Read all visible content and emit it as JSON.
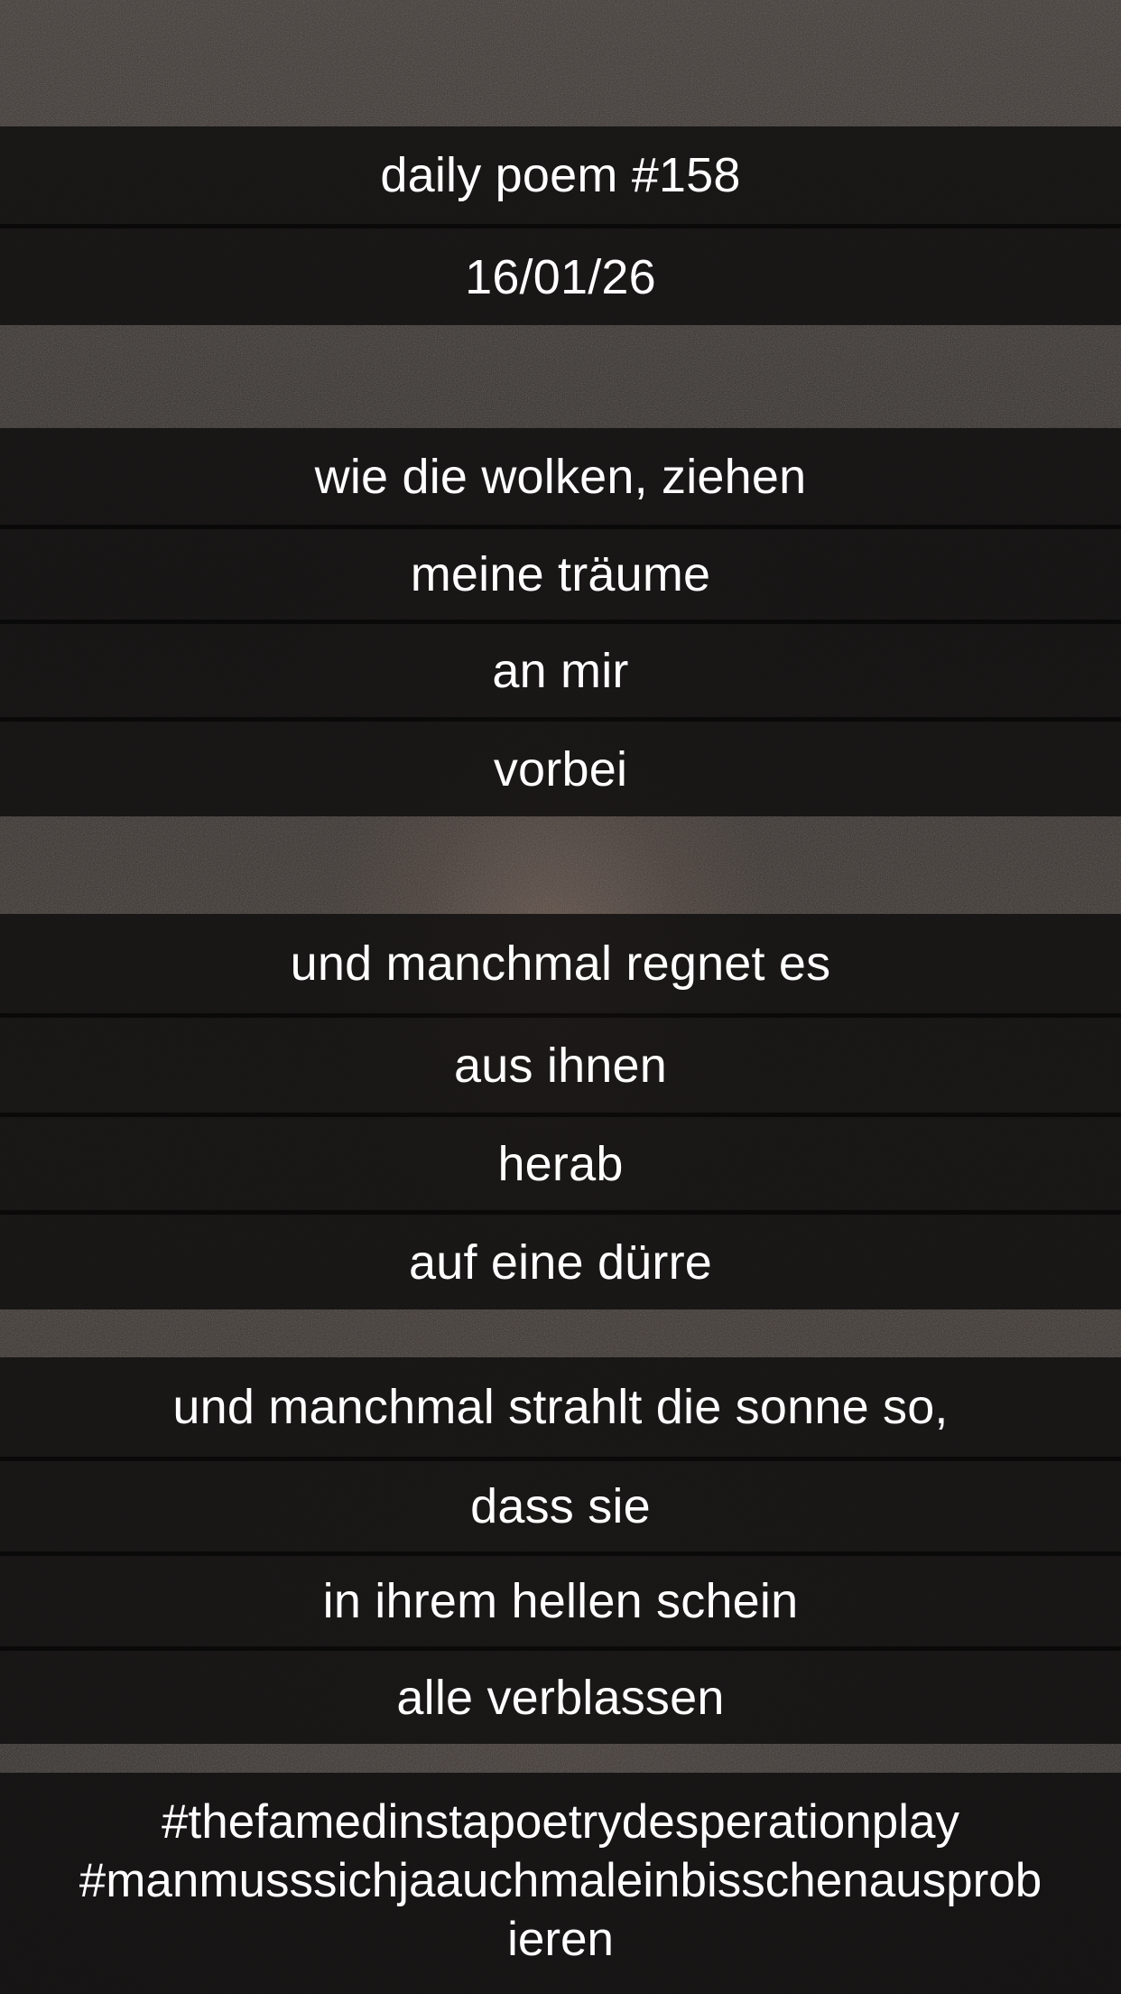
{
  "header": {
    "title": "daily poem #158",
    "date": "16/01/26"
  },
  "poem": {
    "stanzas": [
      [
        "wie die wolken, ziehen",
        "meine träume",
        "an mir",
        "vorbei"
      ],
      [
        "und manchmal regnet es",
        "aus ihnen",
        "herab",
        "auf eine dürre"
      ],
      [
        "und manchmal strahlt die sonne so,",
        "dass sie",
        "in ihrem hellen schein",
        "alle verblassen"
      ]
    ]
  },
  "hashtags": {
    "line1": "#thefamedinstapoetrydesperationplay",
    "line2": "#manmusssichjaauchmaleinbisschenausprob",
    "line3": "ieren"
  }
}
